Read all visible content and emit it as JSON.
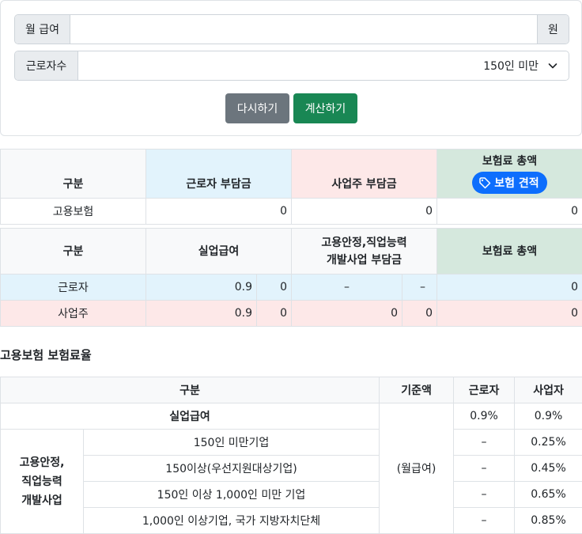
{
  "form": {
    "salary_label": "월 급여",
    "salary_value": "",
    "salary_unit": "원",
    "workers_label": "근로자수",
    "workers_selected": "150인 미만",
    "reset_label": "다시하기",
    "calc_label": "계산하기"
  },
  "summary": {
    "col_category": "구분",
    "col_worker": "근로자 부담금",
    "col_employer": "사업주 부담금",
    "col_total": "보험료 총액",
    "badge_label": "보험 견적",
    "row_label": "고용보험",
    "worker_amount": "0",
    "employer_amount": "0",
    "total_amount": "0"
  },
  "detail": {
    "col_category": "구분",
    "col_unemployment": "실업급여",
    "col_stability_1": "고용안정,직업능력",
    "col_stability_2": "개발사업 부담금",
    "col_total": "보험료 총액",
    "rows": [
      {
        "label": "근로자",
        "rate": "0.9",
        "amount": "0",
        "st_rate": "–",
        "st_amount": "–",
        "total": "0"
      },
      {
        "label": "사업주",
        "rate": "0.9",
        "amount": "0",
        "st_rate": "0",
        "st_amount": "0",
        "total": "0"
      }
    ]
  },
  "rates": {
    "title": "고용보험 보험료율",
    "col_category": "구분",
    "col_base": "기준액",
    "col_worker": "근로자",
    "col_employer": "사업자",
    "unemployment_label": "실업급여",
    "unemployment_worker": "0.9%",
    "unemployment_employer": "0.9%",
    "base_value": "(월급여)",
    "stability_label_1": "고용안정,",
    "stability_label_2": "직업능력",
    "stability_label_3": "개발사업",
    "rows": [
      {
        "label": "150인 미만기업",
        "worker": "–",
        "employer": "0.25%"
      },
      {
        "label": "150이상(우선지원대상기업)",
        "worker": "–",
        "employer": "0.45%"
      },
      {
        "label": "150인 이상 1,000인 미만 기업",
        "worker": "–",
        "employer": "0.65%"
      },
      {
        "label": "1,000인 이상기업, 국가 지방자치단체",
        "worker": "–",
        "employer": "0.85%"
      }
    ]
  },
  "icons": {
    "badge": "tag-icon",
    "select": "chevron-down-icon"
  },
  "colors": {
    "worker_bg": "#e2f3fc",
    "employer_bg": "#fde8e8",
    "total_bg": "#d5e8dd",
    "reset": "#6c757d",
    "calc": "#198754",
    "badge": "#0d6efd"
  }
}
